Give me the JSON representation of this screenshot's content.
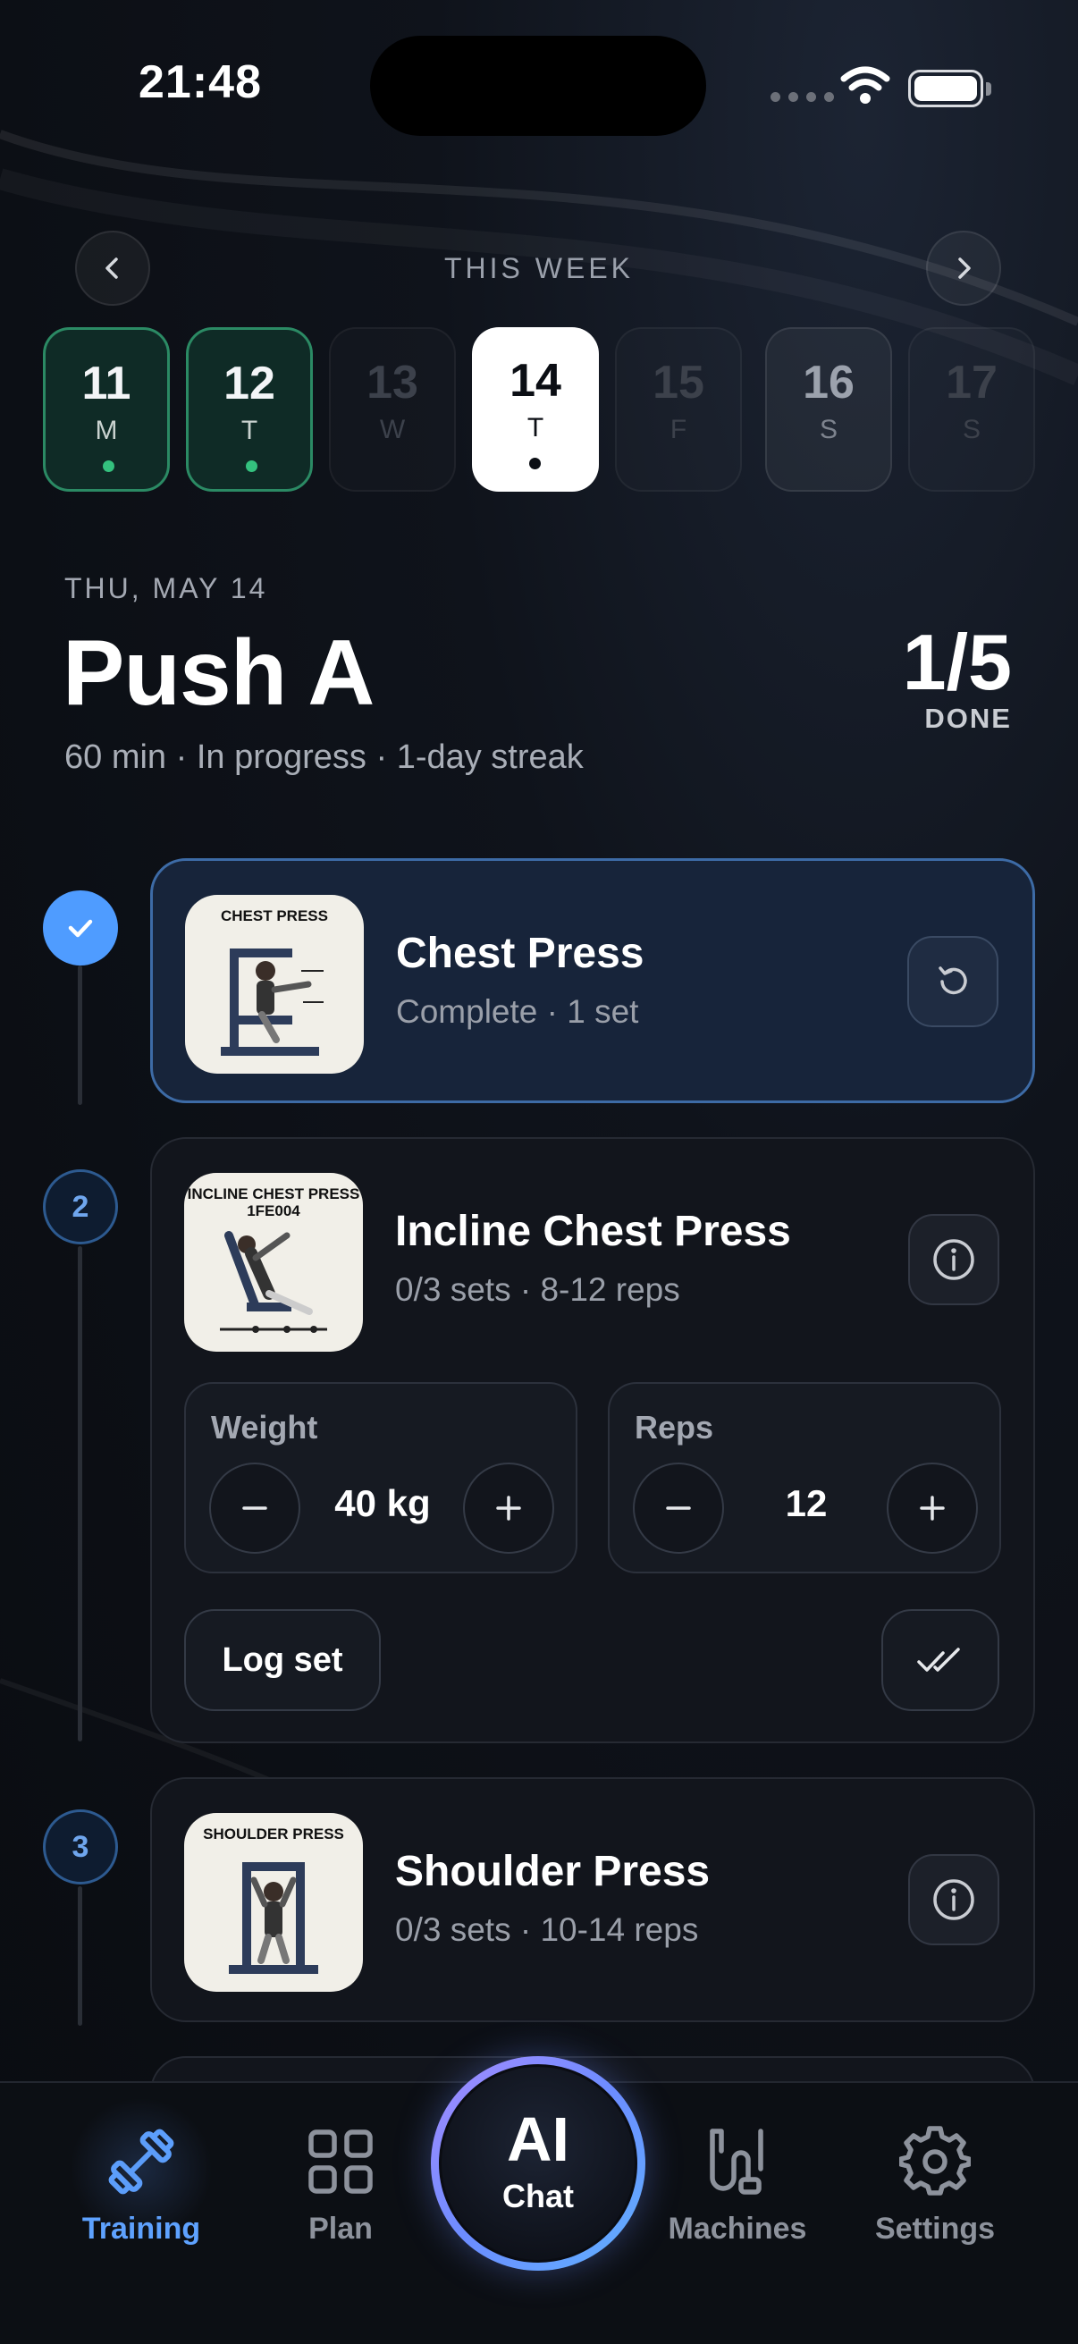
{
  "status_bar": {
    "time": "21:48"
  },
  "week": {
    "title": "THIS WEEK",
    "days": [
      {
        "num": "11",
        "label": "M",
        "state": "done"
      },
      {
        "num": "12",
        "label": "T",
        "state": "done"
      },
      {
        "num": "13",
        "label": "W",
        "state": "future"
      },
      {
        "num": "14",
        "label": "T",
        "state": "today"
      },
      {
        "num": "15",
        "label": "F",
        "state": "future"
      },
      {
        "num": "16",
        "label": "S",
        "state": "future"
      },
      {
        "num": "17",
        "label": "S",
        "state": "future"
      }
    ]
  },
  "workout": {
    "date": "THU, MAY 14",
    "title": "Push A",
    "meta": "60 min · In progress · 1-day streak",
    "progress": "1/5",
    "progress_label": "DONE"
  },
  "exercises": [
    {
      "index": "1",
      "name": "Chest Press",
      "subtitle": "Complete · 1 set",
      "thumb_title": "CHEST PRESS",
      "status": "complete"
    },
    {
      "index": "2",
      "name": "Incline Chest Press",
      "subtitle": "0/3 sets · 8-12 reps",
      "thumb_title": "INCLINE CHEST PRESS 1FE004",
      "status": "active",
      "weight_label": "Weight",
      "weight_value": "40 kg",
      "reps_label": "Reps",
      "reps_value": "12",
      "log_label": "Log set"
    },
    {
      "index": "3",
      "name": "Shoulder Press",
      "subtitle": "0/3 sets · 10-14 reps",
      "thumb_title": "SHOULDER PRESS",
      "status": "pending"
    }
  ],
  "nav": {
    "training": "Training",
    "plan": "Plan",
    "ai_big": "AI",
    "ai_small": "Chat",
    "machines": "Machines",
    "settings": "Settings"
  },
  "colors": {
    "accent": "#4f9cff",
    "done_green": "#34c17e",
    "background": "#0c0f15"
  }
}
